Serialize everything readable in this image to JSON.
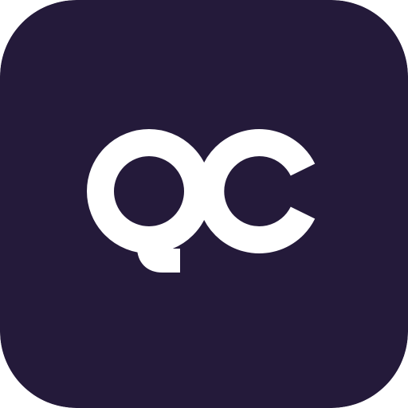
{
  "icon": {
    "name": "qc-app-icon",
    "logo_text": "QC",
    "colors": {
      "background": "#241a3a",
      "foreground": "#ffffff"
    }
  }
}
